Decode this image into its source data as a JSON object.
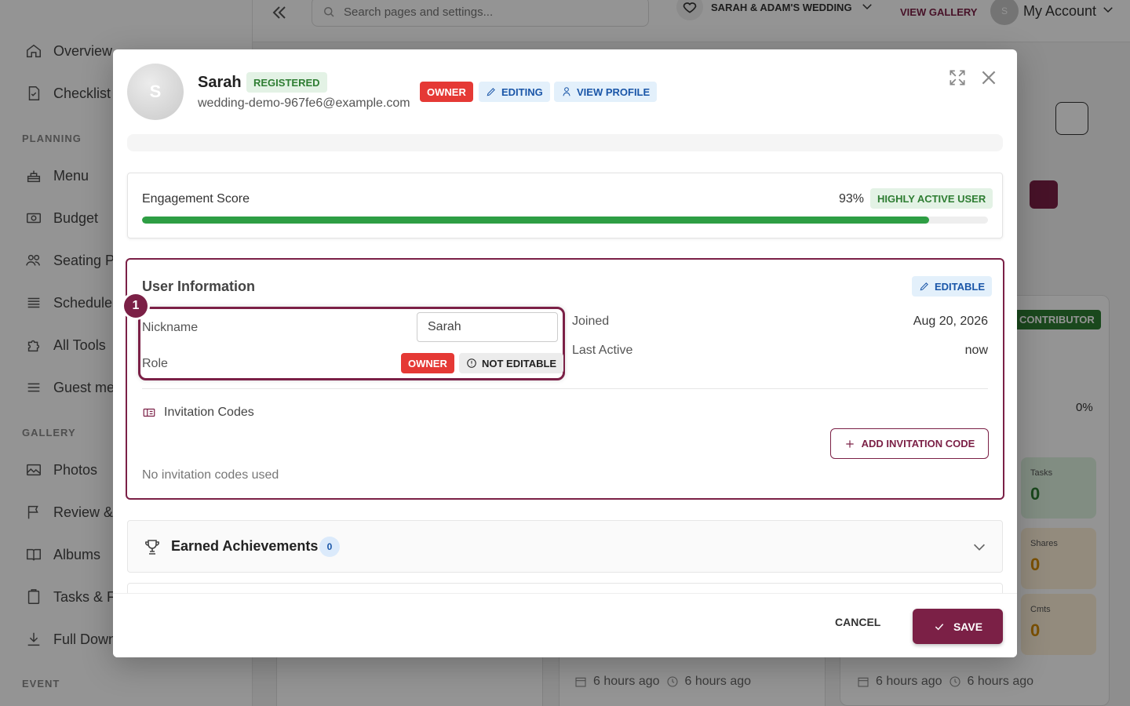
{
  "sidebar": {
    "items": [
      {
        "label": "Overview",
        "icon": "home-icon"
      },
      {
        "label": "Checklist",
        "icon": "document-icon"
      },
      {
        "label": "Menu",
        "icon": "cake-icon"
      },
      {
        "label": "Budget",
        "icon": "money-icon"
      },
      {
        "label": "Seating P",
        "icon": "people-icon"
      },
      {
        "label": "Schedule",
        "icon": "list-icon"
      },
      {
        "label": "All Tools",
        "icon": "puzzle-icon"
      },
      {
        "label": "Guest me",
        "icon": "menu-icon"
      },
      {
        "label": "Photos",
        "icon": "image-icon"
      },
      {
        "label": "Review &",
        "icon": "flag-icon"
      },
      {
        "label": "Albums",
        "icon": "book-icon"
      },
      {
        "label": "Tasks & F",
        "icon": "clipboard-icon"
      },
      {
        "label": "Full Down",
        "icon": "download-icon"
      }
    ],
    "sections": {
      "planning": "PLANNING",
      "gallery": "GALLERY",
      "event": "EVENT"
    }
  },
  "topbar": {
    "search_placeholder": "Search pages and settings...",
    "wedding_name": "SARAH & ADAM'S WEDDING",
    "view_gallery": "VIEW GALLERY",
    "account_initial": "S",
    "account_label": "My Account"
  },
  "background": {
    "contributor_badge": "CONTRIBUTOR",
    "pct": "0%",
    "stats": [
      {
        "title": "Tasks",
        "value": "0",
        "bg": "#dff3e0",
        "color": "#2e7d32"
      },
      {
        "title": "Shares",
        "value": "0",
        "bg": "#fdf0d8",
        "color": "#d48a00"
      },
      {
        "title": "Cmts",
        "value": "0",
        "bg": "#fdf0d8",
        "color": "#d48a00"
      }
    ],
    "time_ago": "6 hours ago"
  },
  "modal": {
    "user": {
      "initial": "S",
      "name": "Sarah",
      "status": "REGISTERED",
      "email": "wedding-demo-967fe6@example.com",
      "role_badge": "OWNER",
      "editing": "EDITING",
      "view_profile": "VIEW PROFILE"
    },
    "engagement": {
      "title": "Engagement Score",
      "score_label": "93%",
      "score": 93,
      "level": "HIGHLY ACTIVE USER"
    },
    "user_info": {
      "title": "User Information",
      "editable": "EDITABLE",
      "step": "1",
      "nickname_label": "Nickname",
      "nickname_value": "Sarah",
      "role_label": "Role",
      "role_value": "OWNER",
      "not_editable": "NOT EDITABLE",
      "joined_label": "Joined",
      "joined_value": "Aug 20, 2026",
      "last_active_label": "Last Active",
      "last_active_value": "now",
      "invitation_title": "Invitation Codes",
      "add_code": "ADD INVITATION CODE",
      "no_codes": "No invitation codes used"
    },
    "achievements": {
      "title": "Earned Achievements",
      "count": "0"
    },
    "footer": {
      "cancel": "CANCEL",
      "save": "SAVE"
    }
  },
  "colors": {
    "brand": "#7b2046",
    "owner_red": "#e53935",
    "success_green": "#2e9e44",
    "info_blue": "#1a56a8"
  }
}
